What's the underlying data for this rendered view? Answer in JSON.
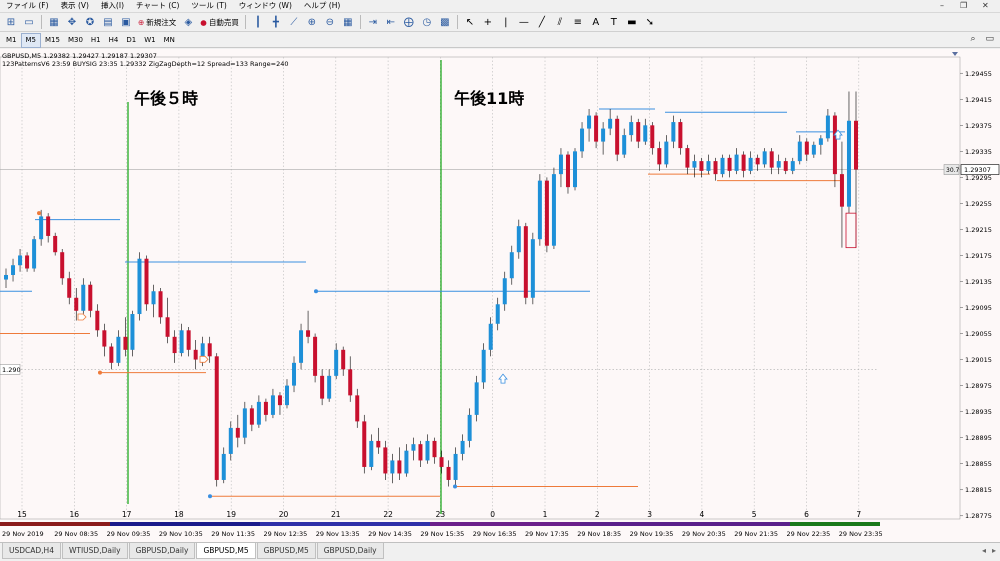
{
  "menu": [
    {
      "label": "ファイル (F)"
    },
    {
      "label": "表示 (V)"
    },
    {
      "label": "挿入(I)"
    },
    {
      "label": "チャート (C)"
    },
    {
      "label": "ツール (T)"
    },
    {
      "label": "ウィンドウ (W)"
    },
    {
      "label": "ヘルプ (H)"
    }
  ],
  "toolbar": {
    "new_order_label": "新規注文",
    "auto_trade_label": "自動売買",
    "font_button_label": "A",
    "text_button_label": "T"
  },
  "timeframes": [
    {
      "label": "M1",
      "active": false
    },
    {
      "label": "M5",
      "active": true
    },
    {
      "label": "M15",
      "active": false
    },
    {
      "label": "M30",
      "active": false
    },
    {
      "label": "H1",
      "active": false
    },
    {
      "label": "H4",
      "active": false
    },
    {
      "label": "D1",
      "active": false
    },
    {
      "label": "W1",
      "active": false
    },
    {
      "label": "MN",
      "active": false
    }
  ],
  "chart": {
    "header_line1": "GBPUSD,M5  1.29382 1.29427 1.29187 1.29307",
    "header_line2": "123PatternsV6  23:59  BUYSIG  23:35  1.29332  ZigZagDepth=12  Spread=133  Range=240",
    "annotation_left": "午後５時",
    "annotation_right": "午後11時",
    "current_price_label": "1.29307",
    "spread_label": "30.7",
    "left_price_tag": "1.290",
    "colors": {
      "bull": "#1e90d8",
      "bear": "#c8102e",
      "green_line": "#22aa22",
      "blue_line": "#3a8fe0",
      "orange_line": "#ee7a3a",
      "background": "#fdf8f8"
    }
  },
  "chart_data": {
    "type": "candlestick",
    "symbol": "GBPUSD",
    "timeframe": "M5",
    "ylim": [
      1.2877,
      1.2948
    ],
    "price_ticks": [
      "1.29455",
      "1.29415",
      "1.29375",
      "1.29335",
      "1.29295",
      "1.29255",
      "1.29215",
      "1.29175",
      "1.29135",
      "1.29095",
      "1.29055",
      "1.29015",
      "1.28975",
      "1.28935",
      "1.28895",
      "1.28855",
      "1.28815",
      "1.28775"
    ],
    "hour_labels": [
      "15",
      "16",
      "17",
      "18",
      "19",
      "20",
      "21",
      "22",
      "23",
      "0",
      "1",
      "2",
      "3",
      "4",
      "5",
      "6",
      "7"
    ],
    "time_labels": [
      "29 Nov 2019",
      "29 Nov 08:35",
      "29 Nov 09:35",
      "29 Nov 10:35",
      "29 Nov 11:35",
      "29 Nov 12:35",
      "29 Nov 13:35",
      "29 Nov 14:35",
      "29 Nov 15:35",
      "29 Nov 16:35",
      "29 Nov 17:35",
      "29 Nov 18:35",
      "29 Nov 19:35",
      "29 Nov 20:35",
      "29 Nov 21:35",
      "29 Nov 22:35",
      "29 Nov 23:35"
    ],
    "candles": [
      [
        1.29138,
        1.29155,
        1.29125,
        1.29145
      ],
      [
        1.29145,
        1.2917,
        1.29135,
        1.2916
      ],
      [
        1.2916,
        1.29185,
        1.2915,
        1.29175
      ],
      [
        1.29175,
        1.2918,
        1.2915,
        1.29155
      ],
      [
        1.29155,
        1.29205,
        1.2915,
        1.292
      ],
      [
        1.292,
        1.29245,
        1.2919,
        1.29235
      ],
      [
        1.29235,
        1.2924,
        1.29195,
        1.29205
      ],
      [
        1.29205,
        1.2921,
        1.29175,
        1.2918
      ],
      [
        1.2918,
        1.29185,
        1.2913,
        1.2914
      ],
      [
        1.2914,
        1.2915,
        1.291,
        1.2911
      ],
      [
        1.2911,
        1.29125,
        1.29075,
        1.2909
      ],
      [
        1.2909,
        1.2914,
        1.29085,
        1.2913
      ],
      [
        1.2913,
        1.29135,
        1.2908,
        1.2909
      ],
      [
        1.2909,
        1.291,
        1.2905,
        1.2906
      ],
      [
        1.2906,
        1.2907,
        1.2902,
        1.29035
      ],
      [
        1.29035,
        1.2904,
        1.29,
        1.2901
      ],
      [
        1.2901,
        1.2906,
        1.29005,
        1.2905
      ],
      [
        1.2905,
        1.2908,
        1.2902,
        1.2903
      ],
      [
        1.2903,
        1.2909,
        1.2902,
        1.29085
      ],
      [
        1.29085,
        1.2918,
        1.29075,
        1.2917
      ],
      [
        1.2917,
        1.29175,
        1.2909,
        1.291
      ],
      [
        1.291,
        1.2913,
        1.2908,
        1.2912
      ],
      [
        1.2912,
        1.29125,
        1.2907,
        1.2908
      ],
      [
        1.2908,
        1.2911,
        1.2904,
        1.2905
      ],
      [
        1.2905,
        1.2906,
        1.2901,
        1.29025
      ],
      [
        1.29025,
        1.2907,
        1.2902,
        1.2906
      ],
      [
        1.2906,
        1.29065,
        1.2902,
        1.2903
      ],
      [
        1.2903,
        1.29045,
        1.29,
        1.29015
      ],
      [
        1.29015,
        1.2905,
        1.29005,
        1.2904
      ],
      [
        1.2904,
        1.2905,
        1.2901,
        1.2902
      ],
      [
        1.2902,
        1.29025,
        1.2882,
        1.2883
      ],
      [
        1.2883,
        1.2888,
        1.28825,
        1.2887
      ],
      [
        1.2887,
        1.2892,
        1.2886,
        1.2891
      ],
      [
        1.2891,
        1.2893,
        1.2888,
        1.28895
      ],
      [
        1.28895,
        1.2895,
        1.28885,
        1.2894
      ],
      [
        1.2894,
        1.28945,
        1.28905,
        1.28915
      ],
      [
        1.28915,
        1.2896,
        1.2891,
        1.2895
      ],
      [
        1.2895,
        1.28955,
        1.2892,
        1.2893
      ],
      [
        1.2893,
        1.2897,
        1.28925,
        1.2896
      ],
      [
        1.2896,
        1.28965,
        1.2893,
        1.28945
      ],
      [
        1.28945,
        1.28985,
        1.2894,
        1.28975
      ],
      [
        1.28975,
        1.2902,
        1.28965,
        1.2901
      ],
      [
        1.2901,
        1.2907,
        1.29,
        1.2906
      ],
      [
        1.2906,
        1.2909,
        1.2904,
        1.2905
      ],
      [
        1.2905,
        1.29055,
        1.2898,
        1.2899
      ],
      [
        1.2899,
        1.29,
        1.28945,
        1.28955
      ],
      [
        1.28955,
        1.29,
        1.2895,
        1.2899
      ],
      [
        1.2899,
        1.2904,
        1.28985,
        1.2903
      ],
      [
        1.2903,
        1.29035,
        1.2899,
        1.29
      ],
      [
        1.29,
        1.2902,
        1.2895,
        1.2896
      ],
      [
        1.2896,
        1.2897,
        1.2891,
        1.2892
      ],
      [
        1.2892,
        1.2893,
        1.2884,
        1.2885
      ],
      [
        1.2885,
        1.289,
        1.28845,
        1.2889
      ],
      [
        1.2889,
        1.2891,
        1.2887,
        1.2888
      ],
      [
        1.2888,
        1.2889,
        1.2883,
        1.2884
      ],
      [
        1.2884,
        1.2887,
        1.28825,
        1.2886
      ],
      [
        1.2886,
        1.2888,
        1.2883,
        1.2884
      ],
      [
        1.2884,
        1.28885,
        1.28835,
        1.28875
      ],
      [
        1.28875,
        1.28895,
        1.2886,
        1.28885
      ],
      [
        1.28885,
        1.2889,
        1.2885,
        1.2886
      ],
      [
        1.2886,
        1.289,
        1.28855,
        1.2889
      ],
      [
        1.2889,
        1.28895,
        1.28855,
        1.28865
      ],
      [
        1.28865,
        1.28875,
        1.2884,
        1.2885
      ],
      [
        1.2885,
        1.2886,
        1.2882,
        1.2883
      ],
      [
        1.2883,
        1.2888,
        1.2882,
        1.2887
      ],
      [
        1.2887,
        1.289,
        1.2886,
        1.2889
      ],
      [
        1.2889,
        1.2894,
        1.2888,
        1.2893
      ],
      [
        1.2893,
        1.2899,
        1.2892,
        1.2898
      ],
      [
        1.2898,
        1.2904,
        1.2897,
        1.2903
      ],
      [
        1.2903,
        1.2908,
        1.2902,
        1.2907
      ],
      [
        1.2907,
        1.2911,
        1.2906,
        1.291
      ],
      [
        1.291,
        1.2915,
        1.2909,
        1.2914
      ],
      [
        1.2914,
        1.2919,
        1.2913,
        1.2918
      ],
      [
        1.2918,
        1.2923,
        1.2917,
        1.2922
      ],
      [
        1.2922,
        1.29225,
        1.291,
        1.2911
      ],
      [
        1.2911,
        1.2921,
        1.291,
        1.292
      ],
      [
        1.292,
        1.293,
        1.2919,
        1.2929
      ],
      [
        1.2929,
        1.29295,
        1.2918,
        1.2919
      ],
      [
        1.2919,
        1.2931,
        1.29185,
        1.293
      ],
      [
        1.293,
        1.2934,
        1.2928,
        1.2933
      ],
      [
        1.2933,
        1.29335,
        1.2927,
        1.2928
      ],
      [
        1.2928,
        1.2934,
        1.29275,
        1.29335
      ],
      [
        1.29335,
        1.2938,
        1.29325,
        1.2937
      ],
      [
        1.2937,
        1.294,
        1.2935,
        1.2939
      ],
      [
        1.2939,
        1.29395,
        1.2934,
        1.2935
      ],
      [
        1.2935,
        1.2938,
        1.2933,
        1.2937
      ],
      [
        1.2937,
        1.294,
        1.2936,
        1.29385
      ],
      [
        1.29385,
        1.2939,
        1.2932,
        1.2933
      ],
      [
        1.2933,
        1.2937,
        1.29325,
        1.2936
      ],
      [
        1.2936,
        1.2939,
        1.2935,
        1.2938
      ],
      [
        1.2938,
        1.29385,
        1.2934,
        1.2935
      ],
      [
        1.2935,
        1.29385,
        1.29345,
        1.29375
      ],
      [
        1.29375,
        1.2938,
        1.2933,
        1.2934
      ],
      [
        1.2934,
        1.2935,
        1.29305,
        1.29315
      ],
      [
        1.29315,
        1.2936,
        1.2931,
        1.2935
      ],
      [
        1.2935,
        1.2939,
        1.2934,
        1.2938
      ],
      [
        1.2938,
        1.29385,
        1.2933,
        1.2934
      ],
      [
        1.2934,
        1.29345,
        1.293,
        1.2931
      ],
      [
        1.2931,
        1.2933,
        1.29295,
        1.2932
      ],
      [
        1.2932,
        1.29325,
        1.29295,
        1.29305
      ],
      [
        1.29305,
        1.2933,
        1.293,
        1.2932
      ],
      [
        1.2932,
        1.29325,
        1.2929,
        1.293
      ],
      [
        1.293,
        1.2933,
        1.29295,
        1.29325
      ],
      [
        1.29325,
        1.2933,
        1.29295,
        1.29305
      ],
      [
        1.29305,
        1.2934,
        1.293,
        1.2933
      ],
      [
        1.2933,
        1.29335,
        1.29295,
        1.29305
      ],
      [
        1.29305,
        1.29335,
        1.293,
        1.29325
      ],
      [
        1.29325,
        1.2933,
        1.29305,
        1.29315
      ],
      [
        1.29315,
        1.2934,
        1.2931,
        1.29335
      ],
      [
        1.29335,
        1.2934,
        1.293,
        1.2931
      ],
      [
        1.2931,
        1.2933,
        1.293,
        1.2932
      ],
      [
        1.2932,
        1.29325,
        1.293,
        1.29305
      ],
      [
        1.29305,
        1.29325,
        1.293,
        1.2932
      ],
      [
        1.2932,
        1.2936,
        1.29315,
        1.2935
      ],
      [
        1.2935,
        1.29355,
        1.2932,
        1.2933
      ],
      [
        1.2933,
        1.2935,
        1.29325,
        1.29345
      ],
      [
        1.29345,
        1.2936,
        1.2933,
        1.29355
      ],
      [
        1.29355,
        1.294,
        1.2935,
        1.2939
      ],
      [
        1.2939,
        1.29395,
        1.2928,
        1.293
      ],
      [
        1.293,
        1.2935,
        1.29187,
        1.2925
      ],
      [
        1.2925,
        1.29427,
        1.2924,
        1.29382
      ],
      [
        1.29382,
        1.29427,
        1.29187,
        1.29307
      ]
    ],
    "horizontal_levels": [
      {
        "price": 1.2923,
        "x1": 35,
        "x2": 120,
        "color": "blue"
      },
      {
        "price": 1.2912,
        "x1": 0,
        "x2": 32,
        "color": "blue"
      },
      {
        "price": 1.29055,
        "x1": 0,
        "x2": 90,
        "color": "orange"
      },
      {
        "price": 1.29165,
        "x1": 125,
        "x2": 306,
        "color": "blue"
      },
      {
        "price": 1.28995,
        "x1": 98,
        "x2": 206,
        "color": "orange"
      },
      {
        "price": 1.2912,
        "x1": 316,
        "x2": 590,
        "color": "blue"
      },
      {
        "price": 1.28805,
        "x1": 210,
        "x2": 440,
        "color": "orange"
      },
      {
        "price": 1.2882,
        "x1": 456,
        "x2": 638,
        "color": "orange"
      },
      {
        "price": 1.294,
        "x1": 599,
        "x2": 655,
        "color": "blue"
      },
      {
        "price": 1.29395,
        "x1": 665,
        "x2": 787,
        "color": "blue"
      },
      {
        "price": 1.293,
        "x1": 648,
        "x2": 710,
        "color": "orange"
      },
      {
        "price": 1.2929,
        "x1": 717,
        "x2": 840,
        "color": "orange"
      },
      {
        "price": 1.29365,
        "x1": 796,
        "x2": 845,
        "color": "blue"
      }
    ]
  },
  "tabs": [
    {
      "label": "USDCAD,H4",
      "active": false
    },
    {
      "label": "WTIUSD,Daily",
      "active": false
    },
    {
      "label": "GBPUSD,Daily",
      "active": false
    },
    {
      "label": "GBPUSD,M5",
      "active": true
    },
    {
      "label": "GBPUSD,M5",
      "active": false
    },
    {
      "label": "GBPUSD,Daily",
      "active": false
    }
  ]
}
